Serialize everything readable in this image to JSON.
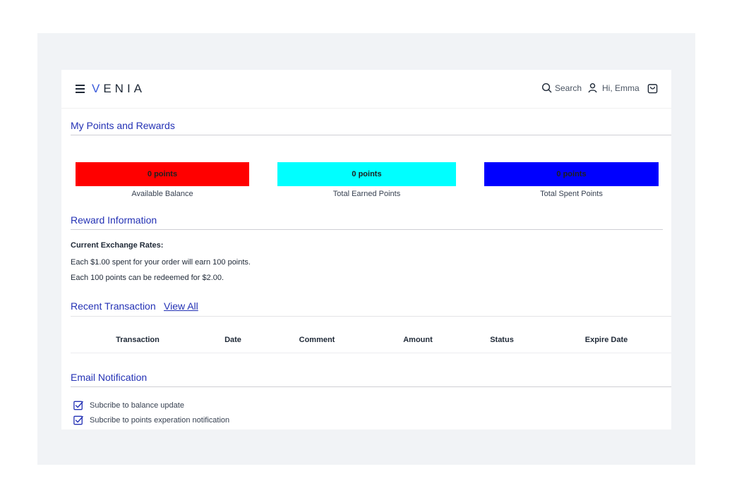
{
  "header": {
    "logo_first": "V",
    "logo_rest": "ENIA",
    "search_label": "Search",
    "greeting": "Hi, Emma"
  },
  "points": {
    "title": "My Points and Rewards",
    "cards": [
      {
        "value": "0 points",
        "caption": "Available Balance",
        "color": "#ff0000"
      },
      {
        "value": "0 points",
        "caption": "Total Earned Points",
        "color": "#00ffff"
      },
      {
        "value": "0 points",
        "caption": "Total Spent Points",
        "color": "#0000ff"
      }
    ]
  },
  "reward_info": {
    "title": "Reward Information",
    "rates_heading": "Current Exchange Rates:",
    "earn_rule": "Each $1.00 spent for your order will earn 100 points.",
    "redeem_rule": "Each 100 points can be redeemed for $2.00."
  },
  "transactions": {
    "title": "Recent Transaction",
    "view_all": "View All",
    "columns": [
      "Transaction",
      "Date",
      "Comment",
      "Amount",
      "Status",
      "Expire Date"
    ]
  },
  "email": {
    "title": "Email Notification",
    "options": [
      {
        "label": "Subcribe to balance update",
        "checked": true
      },
      {
        "label": "Subcribe to points experation notification",
        "checked": true
      }
    ]
  },
  "colors": {
    "accent": "#2432b5",
    "frame_bg": "#f1f3f6"
  }
}
